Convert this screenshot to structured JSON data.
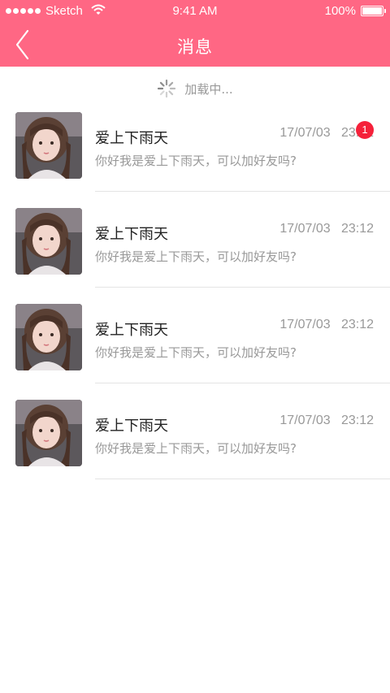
{
  "status_bar": {
    "carrier": "Sketch",
    "time": "9:41 AM",
    "battery": "100%"
  },
  "nav": {
    "title": "消息",
    "back_icon": "chevron-left-icon"
  },
  "loading": {
    "text": "加载中..."
  },
  "messages": [
    {
      "name": "爱上下雨天",
      "preview": "你好我是爱上下雨天，可以加好友吗?",
      "date": "17/07/03",
      "time": "23:12",
      "unread": "1"
    },
    {
      "name": "爱上下雨天",
      "preview": "你好我是爱上下雨天，可以加好友吗?",
      "date": "17/07/03",
      "time": "23:12"
    },
    {
      "name": "爱上下雨天",
      "preview": "你好我是爱上下雨天，可以加好友吗?",
      "date": "17/07/03",
      "time": "23:12"
    },
    {
      "name": "爱上下雨天",
      "preview": "你好我是爱上下雨天，可以加好友吗?",
      "date": "17/07/03",
      "time": "23:12"
    }
  ],
  "colors": {
    "header": "#ff6784",
    "badge": "#f5213a",
    "muted_text": "#999999",
    "primary_text": "#222222"
  }
}
